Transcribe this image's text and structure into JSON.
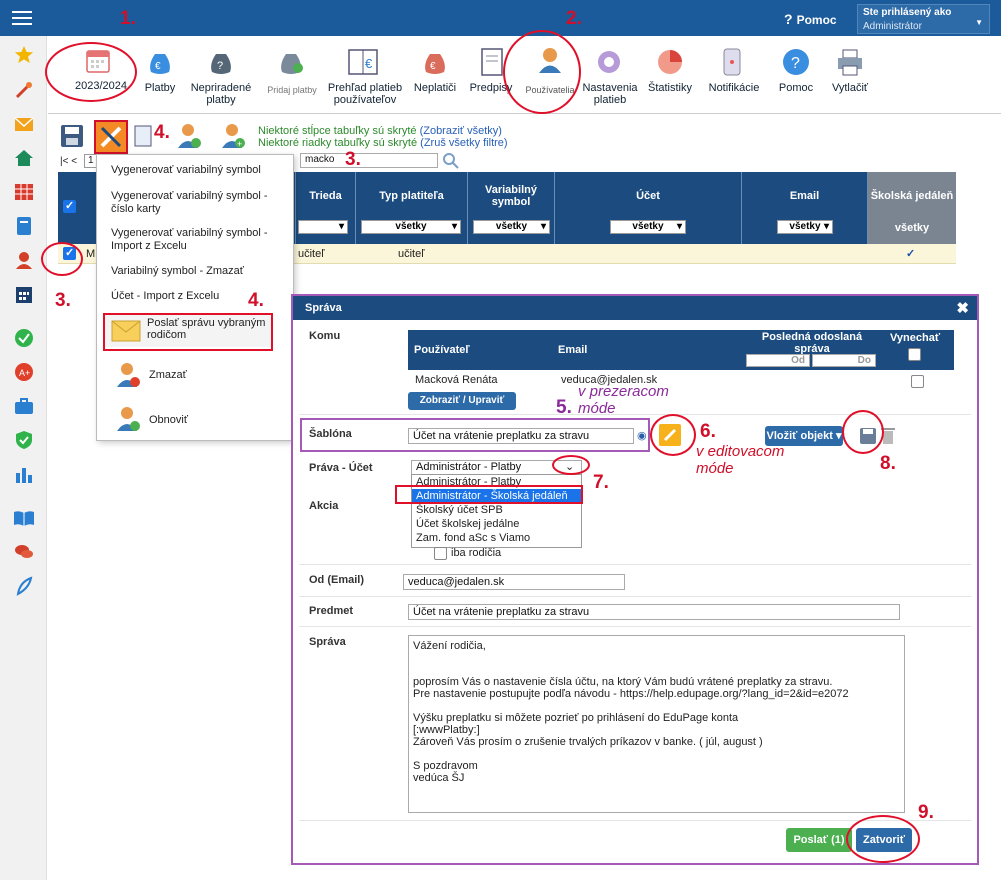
{
  "header": {
    "help": "Pomoc",
    "login_label": "Ste prihlásený ako",
    "login_value": "Administrátor"
  },
  "toolbar": {
    "year": "2023/2024",
    "items": [
      "Platby",
      "Nepriradené platby",
      "Pridaj platby",
      "Prehľad platieb používateľov",
      "Neplatiči",
      "Predpisy",
      "Používatelia",
      "Nastavenia platieb",
      "Štatistiky",
      "Notifikácie",
      "Pomoc",
      "Vytlačiť"
    ]
  },
  "hints": {
    "cols": "Niektoré stĺpce tabuľky sú skryté",
    "cols_link": "(Zobraziť všetky)",
    "rows": "Niektoré riadky tabuľky sú skryté",
    "rows_link": "(Zruš všetky filtre)"
  },
  "pager": {
    "first": "|< <",
    "page": "1"
  },
  "search": {
    "value": "macko"
  },
  "grid": {
    "columns": [
      "Trieda",
      "Typ platiteľa",
      "Variabilný symbol",
      "Účet",
      "Email",
      "Školská jedáleň"
    ],
    "filter": "všetky",
    "row": {
      "name_prefix": "M",
      "trieda": "učiteľ",
      "typ": "učiteľ",
      "check": "✓"
    }
  },
  "context_menu": {
    "items": [
      "Vygenerovať variabilný symbol",
      "Vygenerovať variabilný symbol - číslo karty",
      "Vygenerovať variabilný symbol - Import z Excelu",
      "Variabilný symbol - Zmazať",
      "Účet - Import z Excelu",
      "Poslať správu vybraným rodičom",
      "Zmazať",
      "Obnoviť"
    ]
  },
  "dialog": {
    "title": "Správa",
    "close": "✖",
    "komu": "Komu",
    "col_user": "Používateľ",
    "col_email": "Email",
    "col_last": "Posledná odoslaná správa",
    "col_skip": "Vynechať",
    "od": "Od",
    "do": "Do",
    "recipient_name": "Macková Renáta",
    "recipient_email": "veduca@jedalen.sk",
    "show_edit": "Zobraziť / Upraviť",
    "sablona_label": "Šablóna",
    "sablona_value": "Účet na vrátenie preplatku za stravu",
    "insert": "Vložiť objekt",
    "prava_label": "Práva - Účet",
    "prava_value": "Administrátor - Platby",
    "options": [
      "Administrátor - Platby",
      "Administrátor - Školská jedáleň",
      "Školský účet SPB",
      "Účet školskej jedálne",
      "Zam. fond aSc s Viamo"
    ],
    "akcia_label": "Akcia",
    "akcia_opt": "iba rodičia",
    "from_label": "Od (Email)",
    "from_value": "veduca@jedalen.sk",
    "subject_label": "Predmet",
    "subject_value": "Účet na vrátenie preplatku za stravu",
    "message_label": "Správa",
    "message": "Vážení rodičia,\n\n\npoprosím Vás o nastavenie čísla účtu, na ktorý Vám budú vrátené preplatky za stravu.\nPre nastavenie postupujte podľa návodu - https://help.edupage.org/?lang_id=2&id=e2072\n\nVýšku preplatku si môžete pozrieť po prihlásení do EduPage konta\n[:wwwPlatby:]\nZároveň Vás prosím o zrušenie trvalých príkazov v banke. ( júl, august )\n\nS pozdravom\nvedúca ŠJ",
    "send": "Poslať (1)",
    "close_btn": "Zatvoriť"
  },
  "annotations": {
    "n1": "1.",
    "n2": "2.",
    "n3": "3.",
    "n3b": "3.",
    "n4": "4.",
    "n4b": "4.",
    "n5": "5.",
    "n5t": "v prezeracom\nmóde",
    "n6": "6.",
    "n6t": "v editovacom\nmóde",
    "n7": "7.",
    "n8": "8.",
    "n9": "9."
  }
}
